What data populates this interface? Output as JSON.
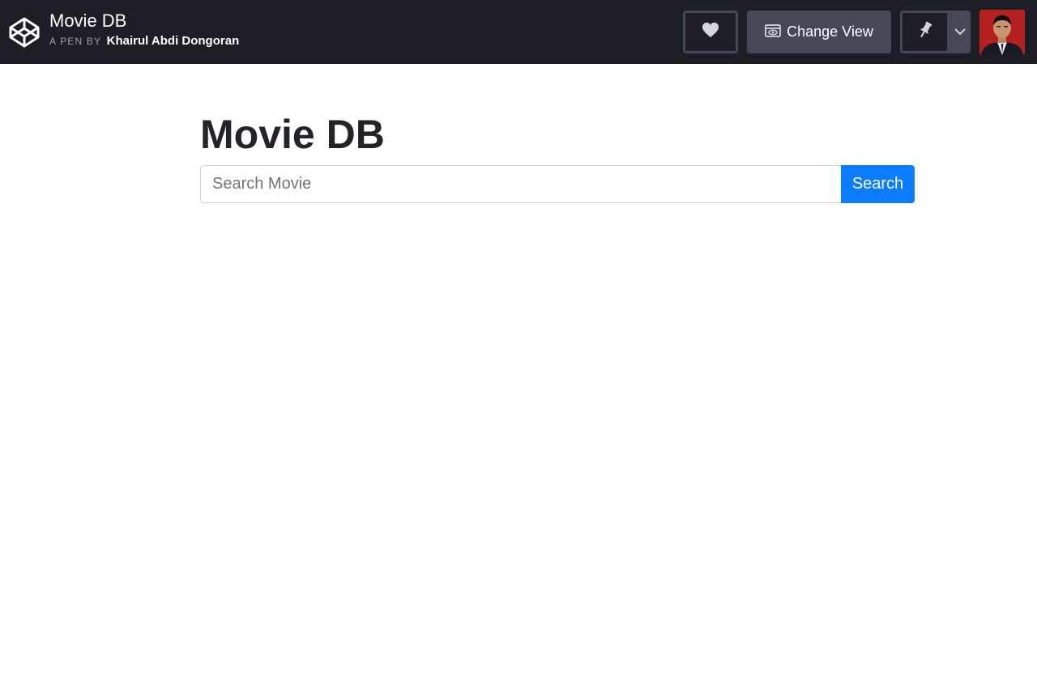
{
  "header": {
    "pen_title": "Movie DB",
    "pen_by_label": "A PEN BY",
    "author": "Khairul Abdi Dongoran",
    "change_view_label": "Change View",
    "icons": {
      "logo": "codepen-logo-icon",
      "heart": "heart-icon",
      "change_view": "change-view-icon",
      "pin": "pin-icon",
      "dropdown": "chevron-down-icon"
    }
  },
  "main": {
    "title": "Movie DB",
    "search": {
      "placeholder": "Search Movie",
      "value": "",
      "button_label": "Search"
    }
  },
  "colors": {
    "topbar_bg": "#1e1f26",
    "topbar_button": "#444857",
    "search_button": "#0b7bff",
    "title_text": "#212529"
  }
}
